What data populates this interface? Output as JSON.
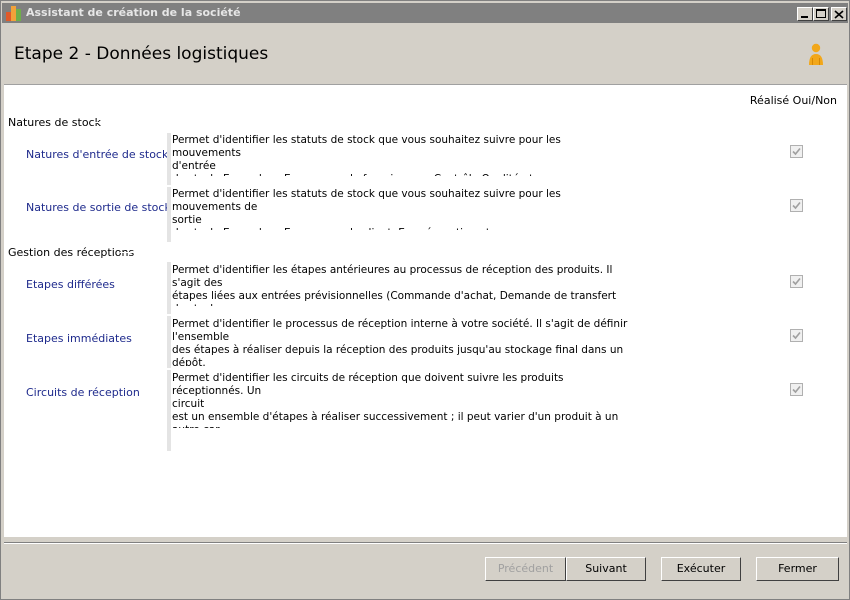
{
  "window": {
    "title": "Assistant de création de la société"
  },
  "header": {
    "step_title": "Etape 2 - Données logistiques",
    "icon": "user-icon"
  },
  "table": {
    "column_header": "Réalisé Oui/Non"
  },
  "sections": [
    {
      "title": "Natures de stock",
      "items": [
        {
          "label": "Natures d'entrée de stock",
          "description": "Permet d'identifier les statuts de stock que vous souhaitez suivre pour les mouvements\nd'entrée\nde stock. Exemples : En commande fournisseurs, Contrôle Qualité etc.",
          "done": true
        },
        {
          "label": "Natures de sortie de stock",
          "description": "Permet d'identifier les statuts de stock que vous souhaitez suivre pour les mouvements de\nsortie\nde stock. Exemples : En commande client, En préparation etc.",
          "done": true
        }
      ]
    },
    {
      "title": "Gestion des réceptions",
      "items": [
        {
          "label": "Etapes différées",
          "description": "Permet d'identifier les étapes antérieures au processus de réception des produits. Il s'agit des\nétapes liées aux entrées prévisionnelles (Commande d'achat, Demande de transfert de stock,\n...).",
          "done": true
        },
        {
          "label": "Etapes immédiates",
          "description": "Permet d'identifier le processus de réception  interne à votre société. Il s'agit de définir\nl'ensemble\ndes étapes à réaliser depuis la réception des produits jusqu'au stockage final dans un dépôt.\nLes étapes font évoluer la nature de stock du mouvement.",
          "done": true
        },
        {
          "label": "Circuits de réception",
          "description": "Permet d'identifier les circuits de réception que doivent suivre les produits réceptionnés. Un\ncircuit\nest un ensemble d'étapes à réaliser successivement ; il peut varier d'un produit à un autre car\ncertaines étapes sont obligatoires pour certains produits et pas pour d'autres.",
          "done": true
        }
      ]
    }
  ],
  "buttons": {
    "previous": "Précédent",
    "next": "Suivant",
    "execute": "Exécuter",
    "close": "Fermer"
  },
  "colors": {
    "link": "#1e2a8c",
    "titlebar": "#808080",
    "dialog_bg": "#d4d0c8"
  }
}
